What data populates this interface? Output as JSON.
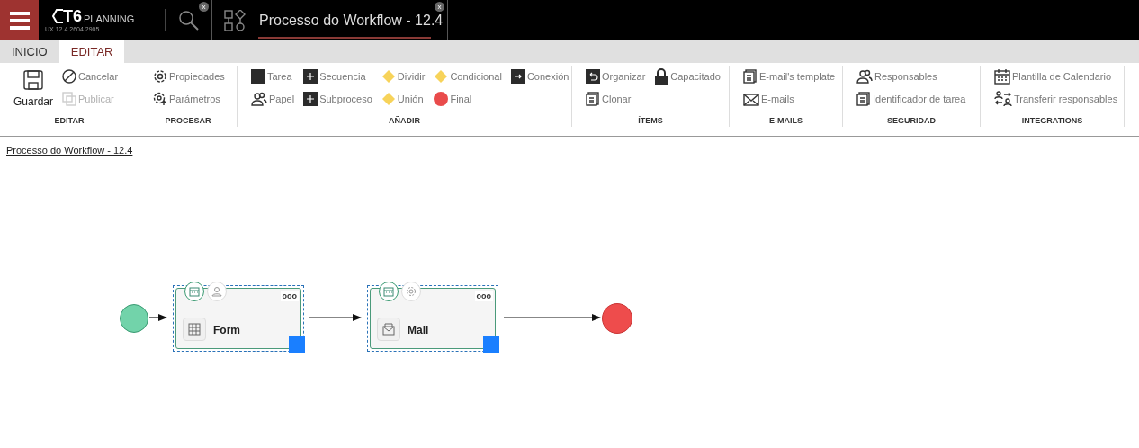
{
  "app": {
    "logo": "T6",
    "brand": "PLANNING",
    "version": "UX 12.4.2604.2905"
  },
  "search_tab": {
    "close": "x"
  },
  "document_tab": {
    "title": "Processo do Workflow - 12.4",
    "close": "x",
    "selected": true
  },
  "ribbon_tabs": [
    {
      "label": "INICIO",
      "selected": false
    },
    {
      "label": "EDITAR",
      "selected": true
    }
  ],
  "groups": [
    {
      "label": "EDITAR",
      "items": [
        {
          "label": "Guardar",
          "disabled": false
        },
        {
          "label": "Cancelar",
          "disabled": false
        },
        {
          "label": "Publicar",
          "disabled": true
        }
      ]
    },
    {
      "label": "PROCESAR",
      "items": [
        {
          "label": "Propiedades",
          "disabled": false
        },
        {
          "label": "Parámetros",
          "disabled": false
        }
      ]
    },
    {
      "label": "AÑADIR",
      "items": [
        {
          "label": "Tarea",
          "disabled": false
        },
        {
          "label": "Papel",
          "disabled": false
        },
        {
          "label": "Secuencia",
          "disabled": false
        },
        {
          "label": "Subproceso",
          "disabled": false
        },
        {
          "label": "Dividir",
          "disabled": false
        },
        {
          "label": "Unión",
          "disabled": false
        },
        {
          "label": "Condicional",
          "disabled": false
        },
        {
          "label": "Final",
          "disabled": false
        },
        {
          "label": "Conexión",
          "disabled": false
        }
      ]
    },
    {
      "label": "ÍTEMS",
      "items": [
        {
          "label": "Organizar",
          "disabled": false
        },
        {
          "label": "Clonar",
          "disabled": false
        },
        {
          "label": "Capacitado",
          "disabled": false
        }
      ]
    },
    {
      "label": "E-MAILS",
      "items": [
        {
          "label": "E-mail's template",
          "disabled": false
        },
        {
          "label": "E-mails",
          "disabled": false
        }
      ]
    },
    {
      "label": "SEGURIDAD",
      "items": [
        {
          "label": "Responsables",
          "disabled": false
        },
        {
          "label": "Identificador de tarea",
          "disabled": false
        }
      ]
    },
    {
      "label": "INTEGRATIONS",
      "items": [
        {
          "label": "Plantilla de Calendario",
          "disabled": false
        },
        {
          "label": "Transferir responsables",
          "disabled": false
        }
      ]
    }
  ],
  "breadcrumb": "Processo do Workflow - 12.4",
  "diagram": {
    "nodes": [
      {
        "kind": "start"
      },
      {
        "kind": "task",
        "label": "Form",
        "more": "ooo",
        "selected": true
      },
      {
        "kind": "task",
        "label": "Mail",
        "more": "ooo",
        "selected": true
      },
      {
        "kind": "end"
      }
    ]
  }
}
